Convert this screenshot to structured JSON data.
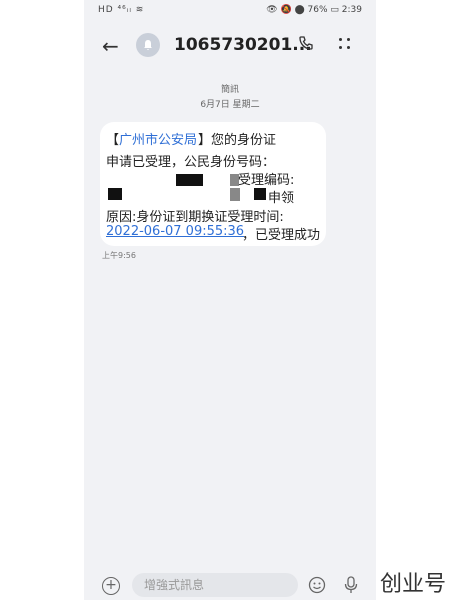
{
  "status_bar": {
    "left": "HD ⁴⁶ᵢₗ ≋",
    "right": "👁 🔕 ⬤ 76% ▭ 2:39"
  },
  "header": {
    "title": "1065730201...",
    "back": "←"
  },
  "meta": {
    "sim_label": "簡訊",
    "date": "6月7日 星期二"
  },
  "message": {
    "agency": "广州市公安局",
    "lines": [
      "【",
      "】您的身份证",
      "申请已受理，公民身份号码：",
      "受理编码:",
      "申领",
      "原因:身份证到期换证受理时间:",
      "2022-06-07 09:55:36",
      "，已受理成功"
    ],
    "time": "上午9:56"
  },
  "composer": {
    "placeholder": "增強式訊息",
    "plus": "+"
  },
  "watermark": "创业号"
}
